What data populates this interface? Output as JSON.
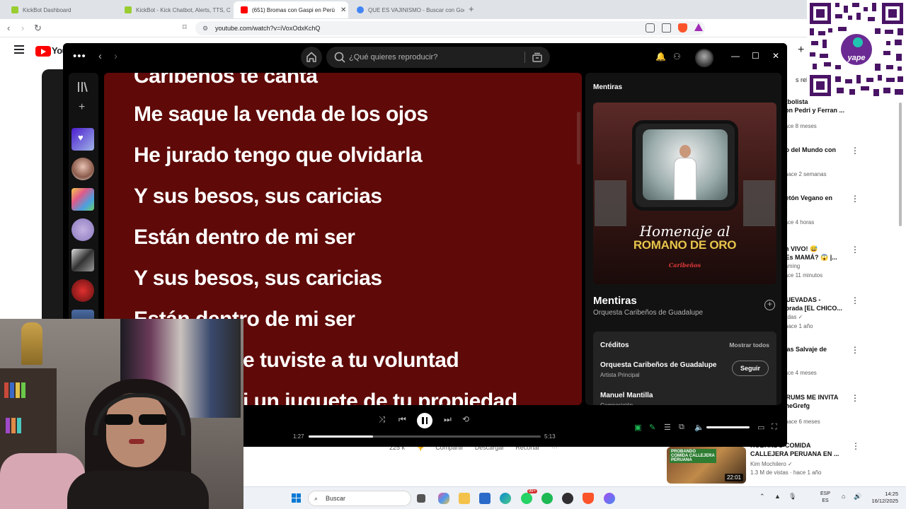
{
  "browser": {
    "tabs": [
      {
        "label": "KickBot Dashboard",
        "color": "#9acd32"
      },
      {
        "label": "KickBot - Kick Chatbot, Alerts, TTS, C",
        "color": "#9acd32"
      },
      {
        "label": "(651) Bromas con Gaspi en Perú",
        "color": "#ff0000"
      },
      {
        "label": "QUE ES VAJINISMO - Buscar con Goo",
        "color": "#4285f4"
      }
    ],
    "url": "youtube.com/watch?v=iVoxOdxKchQ",
    "new_tab": "+"
  },
  "youtube": {
    "logo_text": "You",
    "actions": [
      "225 k",
      "Compartir",
      "Descargar",
      "Recortar"
    ],
    "related_fragment": "s rela",
    "recs": [
      {
        "title": "utbolista\ncon Pedri y Ferran ...",
        "meta": "hace 8 meses"
      },
      {
        "title": "do del Mundo con",
        "meta": "· hace 2 semanas"
      },
      {
        "title": "netón Vegano en",
        "meta": "hace 4 horas"
      },
      {
        "title": "en VIVO! 😅\n¿Es MAMÁ? 😱  |...",
        "meta": "eaming\nhace 11 minutos"
      },
      {
        "title": "HUEVADAS -\nporada [EL CHICO...",
        "meta": "vadas ✓\n· hace 1 año"
      },
      {
        "title": "Mas Salvaje de",
        "meta": "✓\nhace 4 meses"
      },
      {
        "title": "DRUMS ME INVITA\nTheGrefg",
        "meta": "· hace 6 meses"
      }
    ],
    "bottom_rec": {
      "title": "ROBANDO COMIDA\nCALLEJERA PERUANA EN ...",
      "channel": "Kim Mochilero ✓",
      "meta": "1.3 M de vistas · hace 1 año",
      "thumb_label": "PROBANDO\nCOMIDA CALLEJERA\nPERUANA",
      "duration": "22:01"
    }
  },
  "qr": {
    "brand": "yape"
  },
  "spotify": {
    "search_placeholder": "¿Qué quieres reproducir?",
    "lyrics": [
      "Caribeños te canta",
      "Me saque la venda de los ojos",
      "He jurado tengo que olvidarla",
      "Y sus besos, sus caricias",
      "Están dentro de mi ser",
      "Y sus besos, sus caricias",
      "Están dentro de mi ser",
      "e tuviste a tu voluntad",
      "i un juguete de tu propiedad"
    ],
    "now_playing": {
      "header": "Mentiras",
      "album_line1": "Homenaje al",
      "album_line2": "ROMANO DE ORO",
      "album_brand": "Caribeños",
      "song": "Mentiras",
      "artist": "Orquesta Caribeños de Guadalupe"
    },
    "credits": {
      "title": "Créditos",
      "show_all": "Mostrar todos",
      "people": [
        {
          "name": "Orquesta Caribeños de Guadalupe",
          "role": "Artista Principal"
        },
        {
          "name": "Manuel Mantilla",
          "role": "Composición"
        }
      ],
      "follow": "Seguir"
    },
    "player": {
      "elapsed": "1:27",
      "total": "5:13",
      "progress": 0.278,
      "volume": 1.0
    }
  },
  "taskbar": {
    "search": "Buscar",
    "lang": "ESP\nES",
    "time": "14:25",
    "date": "16/12/2025",
    "badges": {
      "whatsapp": "99+"
    }
  }
}
